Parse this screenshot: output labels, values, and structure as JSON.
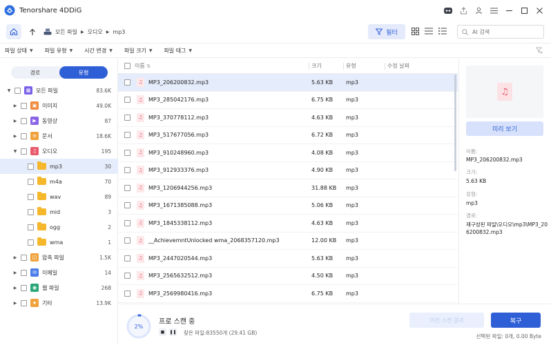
{
  "app": {
    "title": "Tenorshare 4DDiG"
  },
  "nav": {
    "breadcrumb": [
      "모든 파일",
      "오디오",
      "mp3"
    ],
    "filter_label": "필터",
    "search_placeholder": "AI 검색"
  },
  "chips": [
    "파일 상태",
    "파일 유형",
    "시간 변경",
    "파일 크기",
    "파일 태그"
  ],
  "segment": {
    "path": "경로",
    "type": "유형"
  },
  "tree": [
    {
      "label": "모든 파일",
      "count": "83.6K",
      "icon": "grid-icon",
      "color": "#7b61e8"
    },
    {
      "label": "이미지",
      "count": "49.0K",
      "icon": "image-icon",
      "color": "#f08a3c"
    },
    {
      "label": "동영상",
      "count": "87",
      "icon": "video-icon",
      "color": "#8a63e6"
    },
    {
      "label": "문서",
      "count": "18.6K",
      "icon": "document-icon",
      "color": "#f0a23c"
    },
    {
      "label": "오디오",
      "count": "195",
      "icon": "audio-icon",
      "color": "#e85a6b"
    },
    {
      "label": "mp3",
      "count": "30"
    },
    {
      "label": "m4a",
      "count": "70"
    },
    {
      "label": "wav",
      "count": "89"
    },
    {
      "label": "mid",
      "count": "3"
    },
    {
      "label": "ogg",
      "count": "2"
    },
    {
      "label": "wma",
      "count": "1"
    },
    {
      "label": "압축 파일",
      "count": "1.5K",
      "icon": "archive-icon",
      "color": "#f0a23c"
    },
    {
      "label": "이메일",
      "count": "14",
      "icon": "email-icon",
      "color": "#4a7be8"
    },
    {
      "label": "웹 파일",
      "count": "268",
      "icon": "web-icon",
      "color": "#2aa876"
    },
    {
      "label": "기타",
      "count": "13.9K",
      "icon": "other-icon",
      "color": "#f0a23c"
    }
  ],
  "list": {
    "headers": {
      "name": "이름",
      "size": "크기",
      "type": "유형",
      "date": "수정 날짜"
    },
    "rows": [
      {
        "name": "MP3_206200832.mp3",
        "size": "5.63 KB",
        "type": "mp3"
      },
      {
        "name": "MP3_285042176.mp3",
        "size": "6.75 KB",
        "type": "mp3"
      },
      {
        "name": "MP3_370778112.mp3",
        "size": "4.63 KB",
        "type": "mp3"
      },
      {
        "name": "MP3_517677056.mp3",
        "size": "6.72 KB",
        "type": "mp3"
      },
      {
        "name": "MP3_910248960.mp3",
        "size": "4.08 KB",
        "type": "mp3"
      },
      {
        "name": "MP3_912933376.mp3",
        "size": "4.90 KB",
        "type": "mp3"
      },
      {
        "name": "MP3_1206944256.mp3",
        "size": "31.88 KB",
        "type": "mp3"
      },
      {
        "name": "MP3_1671385088.mp3",
        "size": "5.06 KB",
        "type": "mp3"
      },
      {
        "name": "MP3_1845338112.mp3",
        "size": "4.63 KB",
        "type": "mp3"
      },
      {
        "name": "__AchievemntUnlocked wma_2068357120.mp3",
        "size": "12.00 KB",
        "type": "mp3"
      },
      {
        "name": "MP3_2447020544.mp3",
        "size": "5.63 KB",
        "type": "mp3"
      },
      {
        "name": "MP3_2565632512.mp3",
        "size": "4.50 KB",
        "type": "mp3"
      },
      {
        "name": "MP3_2569980416.mp3",
        "size": "6.75 KB",
        "type": "mp3"
      }
    ]
  },
  "preview": {
    "button": "미리 보기",
    "name_label": "이름:",
    "name_value": "MP3_206200832.mp3",
    "size_label": "크기:",
    "size_value": "5.63 KB",
    "type_label": "유형:",
    "type_value": "mp3",
    "path_label": "경로:",
    "path_value": "재구성된 파일\\오디오\\mp3\\MP3_206200832.mp3"
  },
  "bottom": {
    "progress": "2%",
    "progress_fraction": 0.02,
    "scan_title": "프로 스캔 중",
    "found": "찾은 파일:83550개 (29.41 GB)",
    "prev_scan": "이전 스캔 결과",
    "recover": "복구",
    "selected_info": "선택된 파일: 0개, 0.00 Byte"
  },
  "colors": {
    "accent": "#2f5fd6",
    "selected_row": "#e5ecfb"
  }
}
